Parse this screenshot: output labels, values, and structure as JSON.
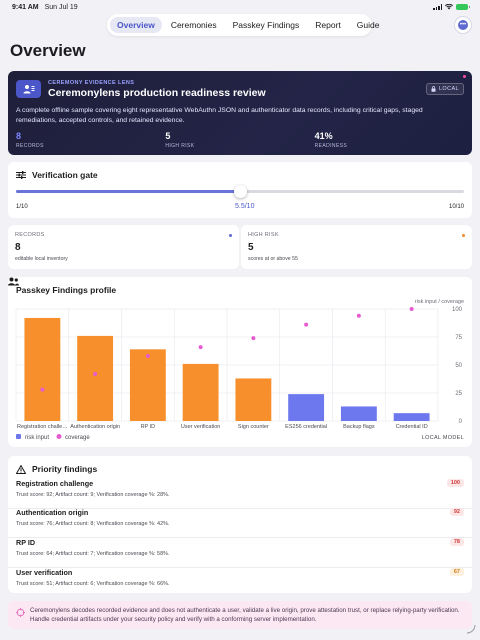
{
  "status": {
    "time": "9:41 AM",
    "date": "Sun Jul 19",
    "battery_color": "#34c759"
  },
  "nav": {
    "tabs": [
      {
        "label": "Overview",
        "active": true
      },
      {
        "label": "Ceremonies",
        "active": false
      },
      {
        "label": "Passkey Findings",
        "active": false
      },
      {
        "label": "Report",
        "active": false
      },
      {
        "label": "Guide",
        "active": false
      }
    ],
    "chat_icon": "chat-bubble-icon"
  },
  "page": {
    "title": "Overview"
  },
  "hero": {
    "eyebrow": "CEREMONY EVIDENCE LENS",
    "title": "Ceremonylens production readiness review",
    "badge": "LOCAL",
    "description": "A complete offline sample covering eight representative WebAuthn JSON and authenticator data records, including critical gaps, staged remediations, accepted controls, and retained evidence.",
    "stats": [
      {
        "value": "8",
        "label": "RECORDS",
        "accent": true
      },
      {
        "value": "5",
        "label": "HIGH RISK",
        "accent": false
      },
      {
        "value": "41%",
        "label": "READINESS",
        "accent": false
      }
    ],
    "colors": {
      "accent": "#7c86ff",
      "icon_bg": "#4b56c9"
    }
  },
  "gate": {
    "title": "Verification gate",
    "min_label": "1/10",
    "max_label": "10/10",
    "value_label": "5.5/10",
    "min": 1,
    "max": 10,
    "value": 5.5
  },
  "metrics": [
    {
      "label": "RECORDS",
      "value": "8",
      "sub": "editable local inventory",
      "dot_color": "#5e6ad2"
    },
    {
      "label": "HIGH RISK",
      "value": "5",
      "sub": "scores at or above 55",
      "dot_color": "#f28b2c"
    }
  ],
  "profile": {
    "title": "Passkey Findings profile",
    "footer": "LOCAL MODEL"
  },
  "chart_data": {
    "type": "bar",
    "ylabel": "risk input / coverage",
    "ylim": [
      0,
      100
    ],
    "yticks": [
      0,
      25,
      50,
      75,
      100
    ],
    "categories": [
      "Registration challe…",
      "Authentication origin",
      "RP ID",
      "User verification",
      "Sign counter",
      "ES256 credential",
      "Backup flags",
      "Credential ID"
    ],
    "series": [
      {
        "name": "risk input",
        "values": [
          92,
          76,
          64,
          51,
          38,
          24,
          13,
          7
        ],
        "high_color": "#f7902c",
        "low_color": "#6e78ee"
      },
      {
        "name": "coverage",
        "values": [
          28,
          42,
          58,
          66,
          74,
          86,
          94,
          100
        ],
        "color": "#e85bd0"
      }
    ],
    "high_threshold": 30,
    "grid": true,
    "legend": "bottom-left"
  },
  "findings": {
    "title": "Priority findings",
    "items": [
      {
        "name": "Registration challenge",
        "meta": "Trust score: 92; Artifact count: 9; Verification coverage %: 28%.",
        "score": "100"
      },
      {
        "name": "Authentication origin",
        "meta": "Trust score: 76; Artifact count: 8; Verification coverage %: 42%.",
        "score": "92"
      },
      {
        "name": "RP ID",
        "meta": "Trust score: 64; Artifact count: 7; Verification coverage %: 58%.",
        "score": "78"
      },
      {
        "name": "User verification",
        "meta": "Trust score: 51; Artifact count: 6; Verification coverage %: 66%.",
        "score": "67"
      }
    ]
  },
  "notice": {
    "text": "Ceremonylens decodes recorded evidence and does not authenticate a user, validate a live origin, prove attestation trust, or replace relying-party verification. Handle credential artifacts under your security policy and verify with a conforming server implementation."
  }
}
